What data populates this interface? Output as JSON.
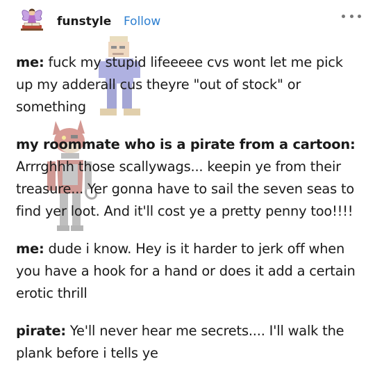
{
  "post": {
    "username": "funstyle",
    "follow_label": "Follow",
    "avatar_icon": "fairy-reading-book-avatar",
    "more_icon": "more-options-icon",
    "colors": {
      "follow": "#2d7fd0",
      "text": "#1a1a1a",
      "background": "#ffffff"
    },
    "dialogue": [
      {
        "speaker": "me:",
        "text": "fuck my stupid lifeeeee cvs wont let me pick up my adderall cus theyre \"out of stock\" or something"
      },
      {
        "speaker": "my roommate who is a pirate from a cartoon:",
        "text": "Arrrghhh those scallywags... keepin ye from their treasure... Yer gonna have to sail the seven seas to find yer loot. And it'll cost ye a pretty penny too!!!!"
      },
      {
        "speaker": "me:",
        "text": "dude i know. Hey is it harder to jerk off when you have a hook for a hand or does it add a certain erotic thrill"
      },
      {
        "speaker": "pirate:",
        "text": "Ye'll never hear me secrets.... I'll walk the plank before i tells ye"
      }
    ]
  }
}
